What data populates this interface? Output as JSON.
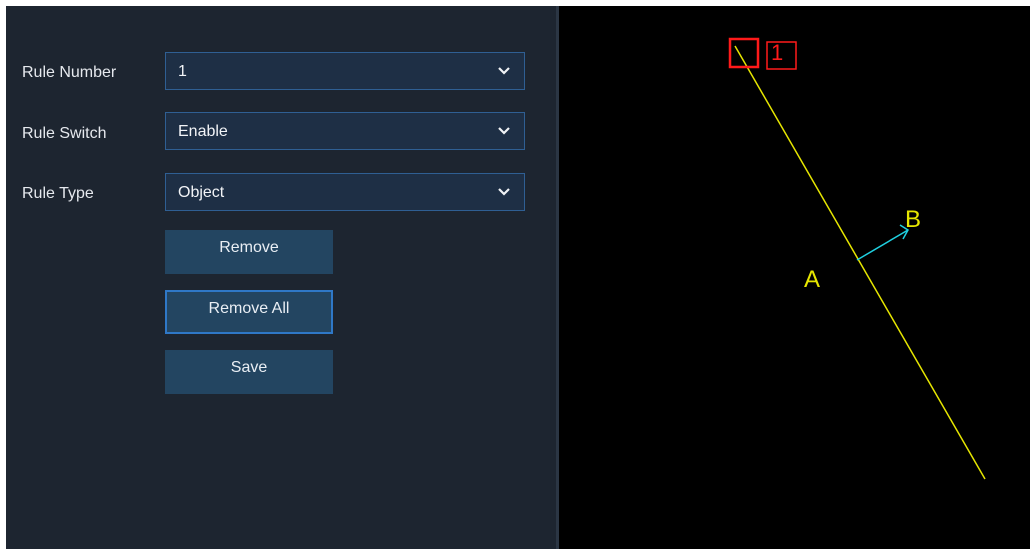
{
  "form": {
    "rule_number": {
      "label": "Rule Number",
      "value": "1"
    },
    "rule_switch": {
      "label": "Rule Switch",
      "value": "Enable"
    },
    "rule_type": {
      "label": "Rule Type",
      "value": "Object"
    }
  },
  "buttons": {
    "remove": "Remove",
    "remove_all": "Remove All",
    "save": "Save"
  },
  "preview": {
    "rule_id": "1",
    "side_a": "A",
    "side_b": "B",
    "colors": {
      "line": "#e6e600",
      "handle": "#ff1a1a",
      "arrow": "#1fd0e0",
      "label_a": "#e6e600",
      "label_b": "#e6e600"
    }
  },
  "icons": {
    "dropdown": "chevron-down-icon",
    "direction": "arrow-icon"
  }
}
